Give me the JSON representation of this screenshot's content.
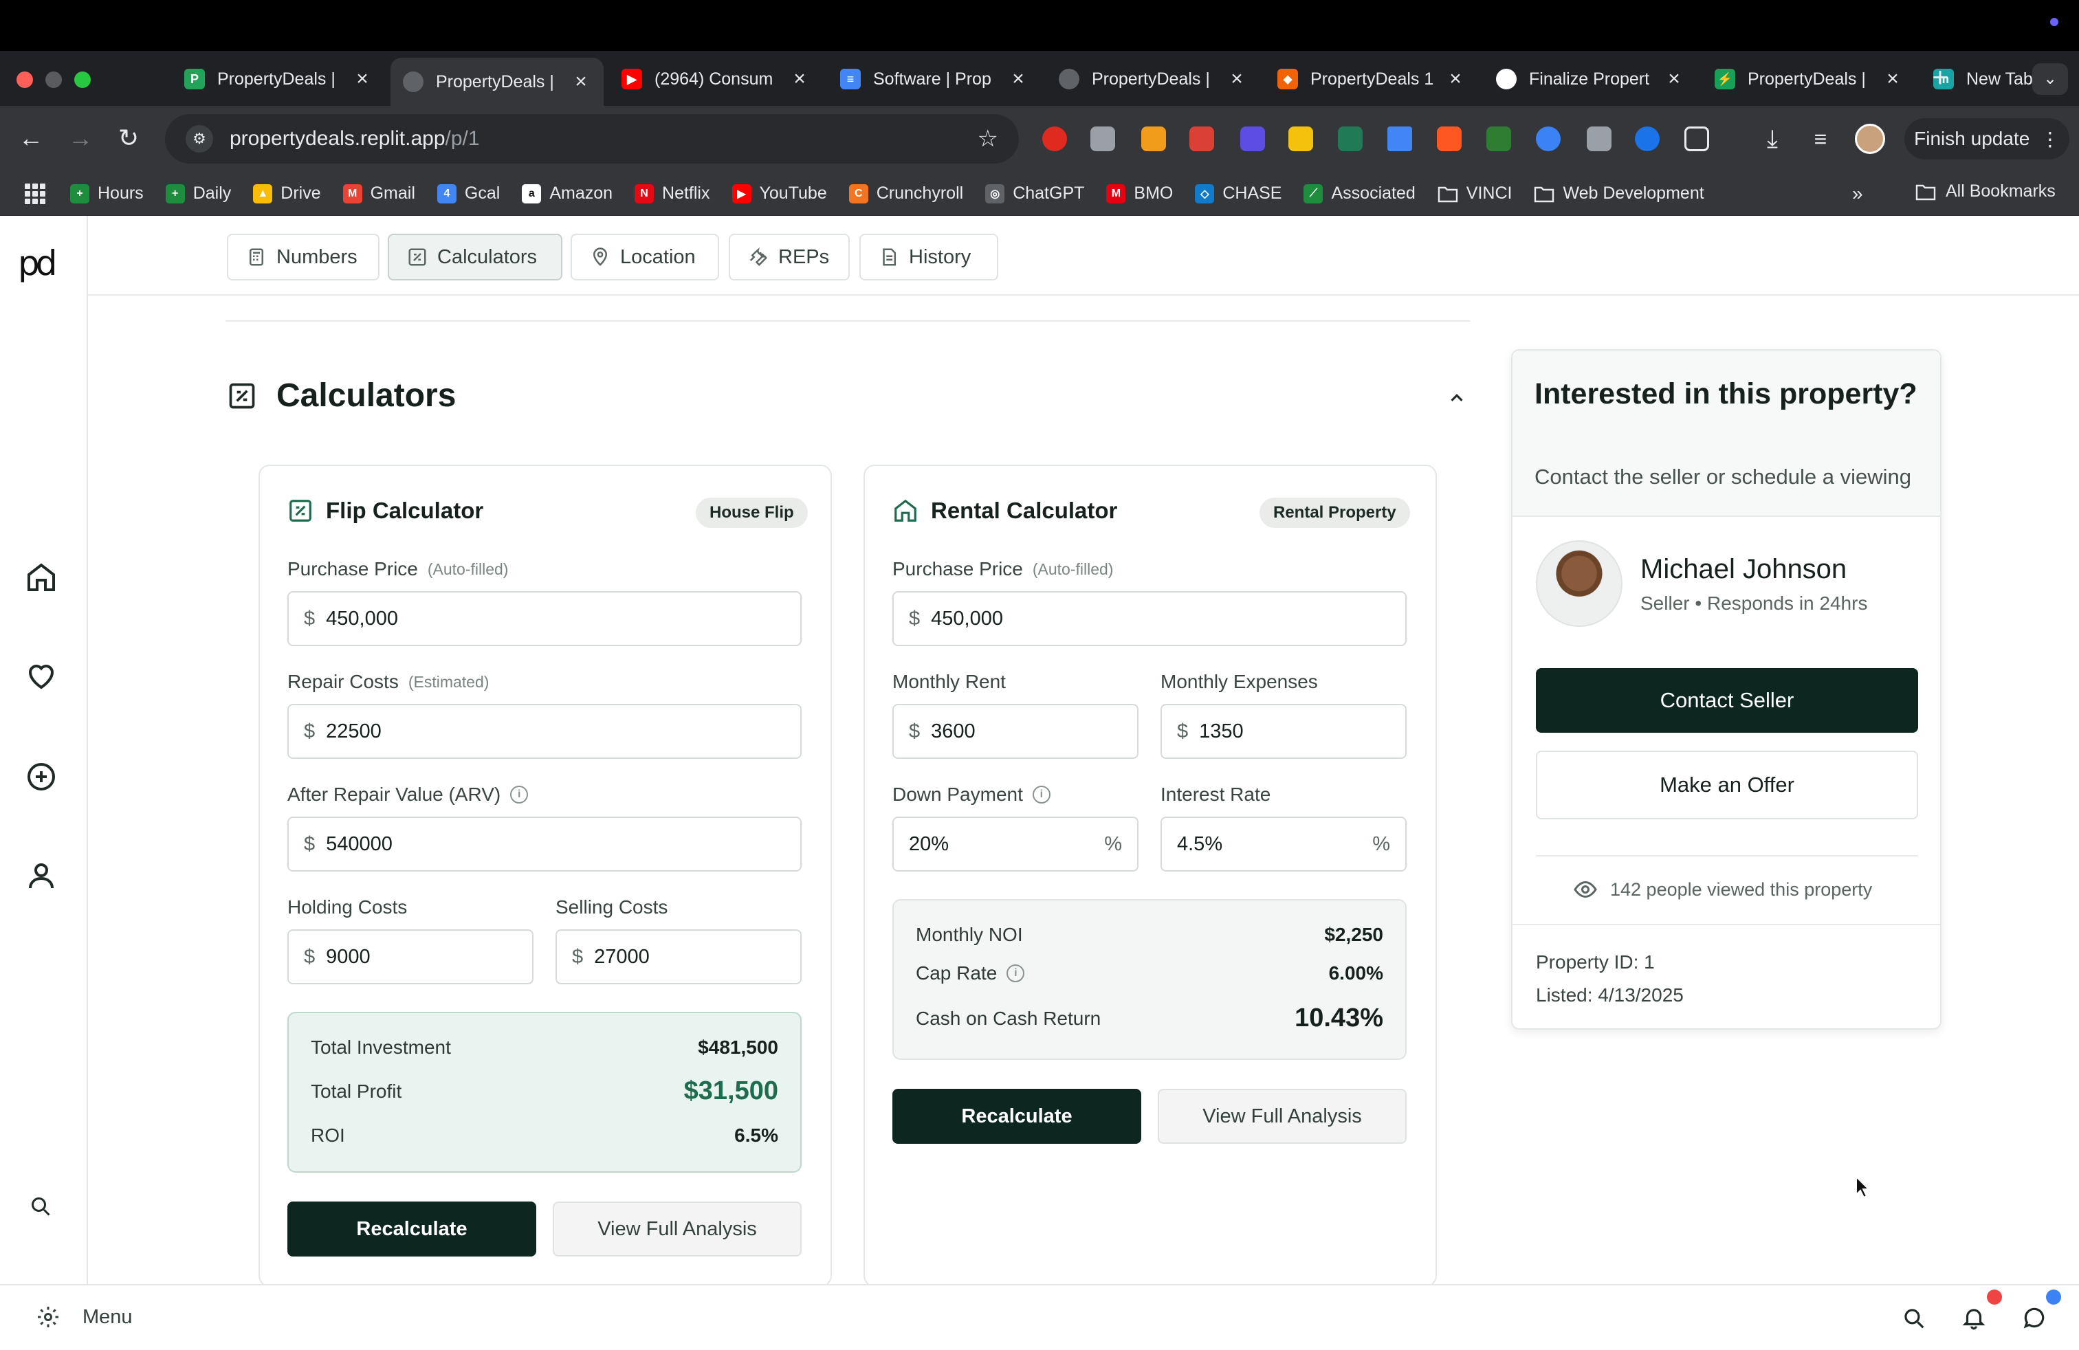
{
  "browser": {
    "tabs": [
      {
        "title": "PropertyDeals |",
        "favicon_color": "#22a35a",
        "favicon_letter": "P",
        "active": false
      },
      {
        "title": "PropertyDeals |",
        "favicon_color": "#5f6368",
        "favicon_letter": "",
        "active": true
      },
      {
        "title": "(2964) Consum",
        "favicon_color": "#ff0000",
        "favicon_letter": "▶",
        "active": false
      },
      {
        "title": "Software | Prop",
        "favicon_color": "#4285f4",
        "favicon_letter": "≡",
        "active": false
      },
      {
        "title": "PropertyDeals |",
        "favicon_color": "#5f6368",
        "favicon_letter": "",
        "active": false
      },
      {
        "title": "PropertyDeals 1",
        "favicon_color": "#f26207",
        "favicon_letter": "⬥",
        "active": false
      },
      {
        "title": "Finalize Propert",
        "favicon_color": "#ffffff",
        "favicon_letter": "",
        "active": false
      },
      {
        "title": "PropertyDeals |",
        "favicon_color": "#18a058",
        "favicon_letter": "⚡",
        "active": false
      },
      {
        "title": "New Tab",
        "favicon_color": "#1aa3a3",
        "favicon_letter": "m",
        "active": false
      }
    ],
    "url_host": "propertydeals.replit.app",
    "url_path": "/p/1",
    "finish_update": "Finish update",
    "bookmarks": [
      {
        "label": "Hours",
        "color": "#1e8e3e",
        "letter": "+"
      },
      {
        "label": "Daily",
        "color": "#1e8e3e",
        "letter": "+"
      },
      {
        "label": "Drive",
        "color": "#fbbc04",
        "letter": "▲"
      },
      {
        "label": "Gmail",
        "color": "#ea4335",
        "letter": "M"
      },
      {
        "label": "Gcal",
        "color": "#4285f4",
        "letter": "4"
      },
      {
        "label": "Amazon",
        "color": "#ffffff",
        "letter": "a"
      },
      {
        "label": "Netflix",
        "color": "#e50914",
        "letter": "N"
      },
      {
        "label": "YouTube",
        "color": "#ff0000",
        "letter": "▶"
      },
      {
        "label": "Crunchyroll",
        "color": "#f47521",
        "letter": "C"
      },
      {
        "label": "ChatGPT",
        "color": "#5f6368",
        "letter": "◎"
      },
      {
        "label": "BMO",
        "color": "#e60012",
        "letter": "M"
      },
      {
        "label": "CHASE",
        "color": "#117aca",
        "letter": "◇"
      },
      {
        "label": "Associated",
        "color": "#1e8e3e",
        "letter": "⟋"
      },
      {
        "label": "VINCI",
        "color": "",
        "letter": "folder"
      },
      {
        "label": "Web Development",
        "color": "",
        "letter": "folder"
      }
    ],
    "all_bookmarks": "All Bookmarks"
  },
  "subnav": {
    "tabs": [
      {
        "label": "Numbers",
        "icon": "calculator-icon"
      },
      {
        "label": "Calculators",
        "icon": "calculator-square-icon",
        "active": true
      },
      {
        "label": "Location",
        "icon": "map-pin-icon"
      },
      {
        "label": "REPs",
        "icon": "wrench-icon"
      },
      {
        "label": "History",
        "icon": "document-icon"
      }
    ]
  },
  "section": {
    "title": "Calculators"
  },
  "flip": {
    "title": "Flip Calculator",
    "badge": "House Flip",
    "purchase_label": "Purchase Price",
    "purchase_hint": "(Auto-filled)",
    "purchase_value": "450,000",
    "repair_label": "Repair Costs",
    "repair_hint": "(Estimated)",
    "repair_value": "22500",
    "arv_label": "After Repair Value (ARV)",
    "arv_value": "540000",
    "holding_label": "Holding Costs",
    "holding_value": "9000",
    "selling_label": "Selling Costs",
    "selling_value": "27000",
    "currency": "$",
    "total_investment_label": "Total Investment",
    "total_investment": "$481,500",
    "total_profit_label": "Total Profit",
    "total_profit": "$31,500",
    "roi_label": "ROI",
    "roi": "6.5%",
    "recalc": "Recalculate",
    "analysis": "View Full Analysis"
  },
  "rental": {
    "title": "Rental Calculator",
    "badge": "Rental Property",
    "purchase_label": "Purchase Price",
    "purchase_hint": "(Auto-filled)",
    "purchase_value": "450,000",
    "rent_label": "Monthly Rent",
    "rent_value": "3600",
    "expenses_label": "Monthly Expenses",
    "expenses_value": "1350",
    "down_label": "Down Payment",
    "down_value": "20%",
    "interest_label": "Interest Rate",
    "interest_value": "4.5%",
    "currency": "$",
    "pct": "%",
    "noi_label": "Monthly NOI",
    "noi": "$2,250",
    "cap_label": "Cap Rate",
    "cap": "6.00%",
    "coc_label": "Cash on Cash Return",
    "coc": "10.43%",
    "recalc": "Recalculate",
    "analysis": "View Full Analysis"
  },
  "seller": {
    "interest_title": "Interested in this property?",
    "interest_sub": "Contact the seller or schedule a viewing",
    "name": "Michael Johnson",
    "role": "Seller",
    "responds": "Responds in 24hrs",
    "contact": "Contact Seller",
    "offer": "Make an Offer",
    "views": "142 people viewed this property",
    "property_id": "Property ID: 1",
    "listed": "Listed: 4/13/2025"
  },
  "bottom": {
    "menu": "Menu"
  }
}
